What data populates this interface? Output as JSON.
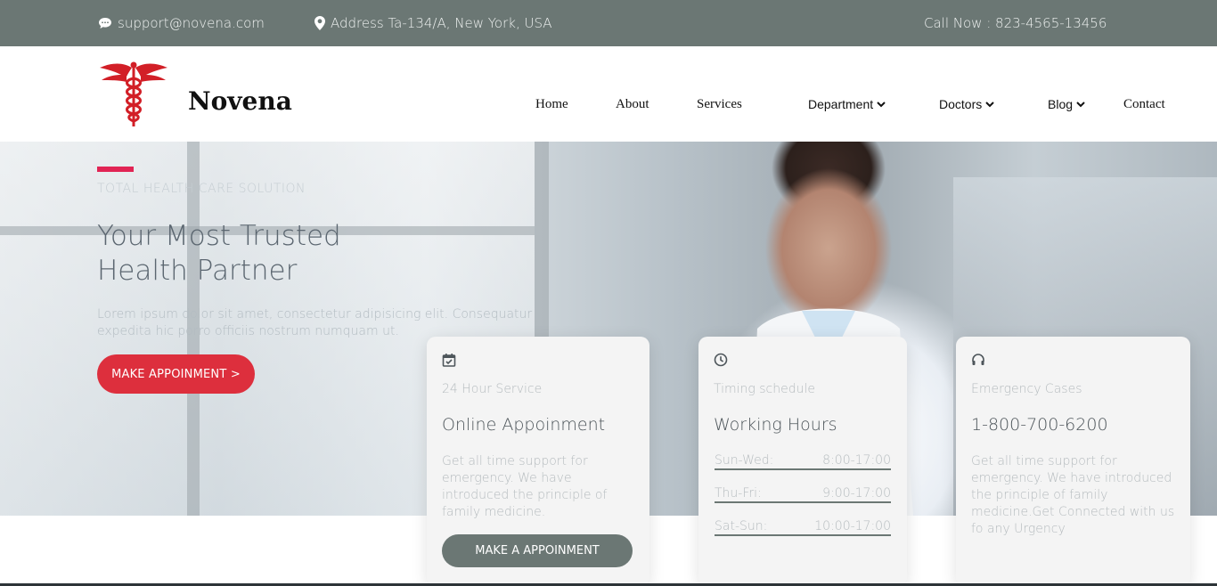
{
  "topbar": {
    "email": "support@novena.com",
    "address": "Address Ta-134/A, New York, USA",
    "call": "Call Now : 823-4565-13456"
  },
  "header": {
    "brand": "Novena",
    "nav": {
      "home": "Home",
      "about": "About",
      "services": "Services",
      "department": "Department",
      "doctors": "Doctors",
      "blog": "Blog",
      "contact": "Contact"
    }
  },
  "hero": {
    "subtitle": "TOTAL HEALTH CARE SOLUTION",
    "title_line1": "Your Most Trusted",
    "title_line2": "Health Partner",
    "text": "Lorem ipsum dolor sit amet, consectetur adipisicing elit. Consequatur expedita hic porro officiis nostrum numquam ut.",
    "button": "MAKE APPOINMENT >"
  },
  "features": [
    {
      "icon": "calendar-check-icon",
      "kicker": "24 Hour Service",
      "heading": "Online Appoinment",
      "desc": "Get all time support for emergency. We have introduced the principle of family medicine.",
      "button": "MAKE A APPOINMENT"
    },
    {
      "icon": "clock-icon",
      "kicker": "Timing schedule",
      "heading": "Working Hours",
      "schedule": [
        {
          "day": "Sun-Wed:",
          "time": "8:00-17:00"
        },
        {
          "day": "Thu-Fri:",
          "time": "9:00-17:00"
        },
        {
          "day": "Sat-Sun:",
          "time": "10:00-17:00"
        }
      ]
    },
    {
      "icon": "headphones-icon",
      "kicker": "Emergency Cases",
      "heading": "1-800-700-6200",
      "desc": "Get all time support for emergency. We have introduced the principle of family medicine.Get Connected with us fo any Urgency"
    }
  ],
  "colors": {
    "topbar": "#6b7774",
    "accent": "#e12454",
    "hero_button": "#dd2f3d",
    "logo_red": "#d21f27"
  }
}
